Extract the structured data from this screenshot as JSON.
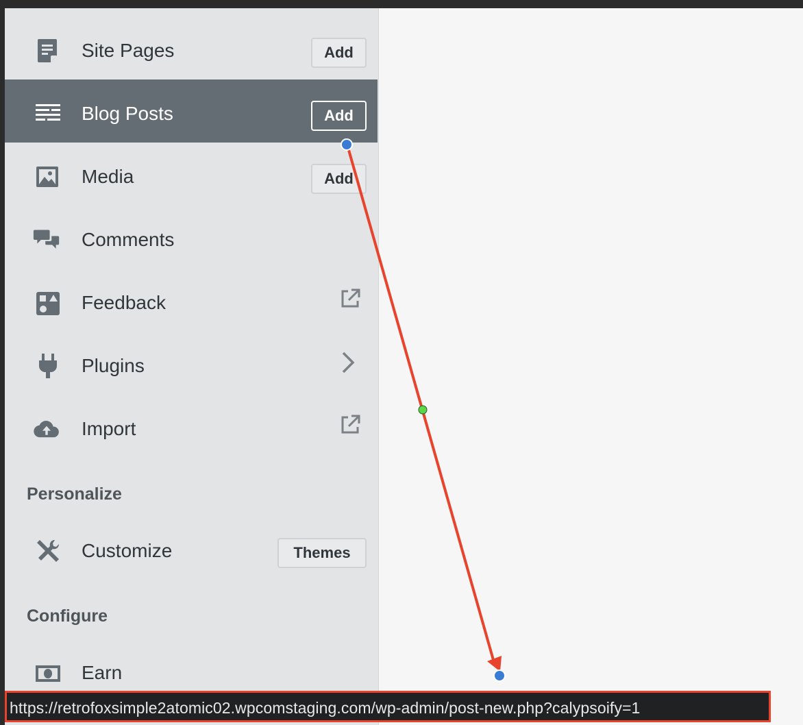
{
  "sidebar": {
    "items": [
      {
        "label": "Site Pages",
        "icon": "page-icon",
        "button": "Add"
      },
      {
        "label": "Blog Posts",
        "icon": "posts-icon",
        "button": "Add",
        "selected": true
      },
      {
        "label": "Media",
        "icon": "image-icon",
        "button": "Add"
      },
      {
        "label": "Comments",
        "icon": "comments-icon"
      },
      {
        "label": "Feedback",
        "icon": "feedback-icon",
        "trailing": "external-link-icon"
      },
      {
        "label": "Plugins",
        "icon": "plugin-icon",
        "trailing": "chevron-right-icon"
      },
      {
        "label": "Import",
        "icon": "cloud-upload-icon",
        "trailing": "external-link-icon"
      }
    ],
    "sections": {
      "personalize": "Personalize",
      "configure": "Configure"
    },
    "customize": {
      "label": "Customize",
      "icon": "tools-icon",
      "button": "Themes"
    },
    "earn": {
      "label": "Earn",
      "icon": "money-icon"
    }
  },
  "status_bar": {
    "url": "https://retrofoxsimple2atomic02.wpcomstaging.com/wp-admin/post-new.php?calypsoify=1"
  },
  "colors": {
    "sidebar_bg": "#e2e4e5",
    "selected_bg": "#646c74",
    "annotation_arrow": "#e8432c",
    "annotation_point": "#3a7bd5",
    "annotation_midpoint": "#5ad84a"
  }
}
